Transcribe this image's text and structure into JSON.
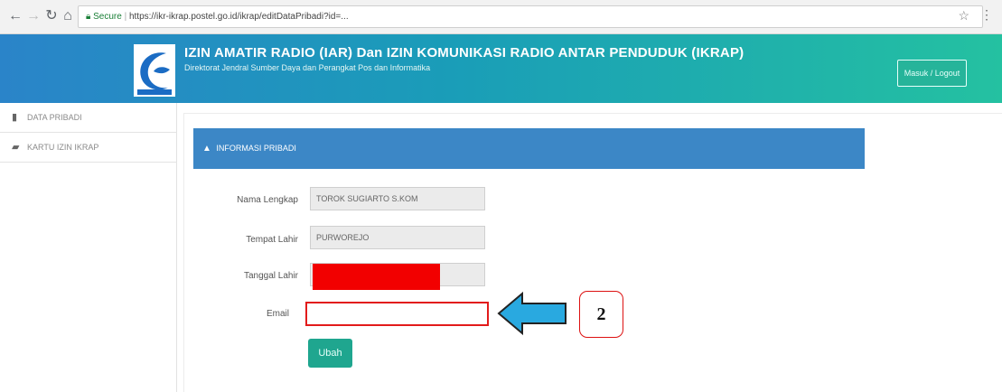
{
  "browser": {
    "secure_label": "Secure",
    "url": "https://ikr-ikrap.postel.go.id/ikrap/editDataPribadi?id=..."
  },
  "header": {
    "title": "IZIN AMATIR RADIO (IAR) Dan IZIN KOMUNIKASI RADIO ANTAR PENDUDUK (IKRAP)",
    "subtitle": "Direktorat Jendral Sumber Daya dan Perangkat Pos dan Informatika",
    "action_button": "Masuk / Logout"
  },
  "sidebar": {
    "items": [
      {
        "label": "DATA PRIBADI",
        "icon": "user-icon"
      },
      {
        "label": "KARTU IZIN IKRAP",
        "icon": "card-icon"
      }
    ]
  },
  "panel": {
    "title": "INFORMASI PRIBADI"
  },
  "form": {
    "nama_label": "Nama Lengkap",
    "nama_value": "TOROK SUGIARTO S.KOM",
    "tempat_label": "Tempat Lahir",
    "tempat_value": "PURWOREJO",
    "tanggal_label": "Tanggal Lahir",
    "email_label": "Email",
    "email_value": "",
    "submit_label": "Ubah"
  },
  "annotation": {
    "step_number": "2",
    "arrow_color": "#29a9e0",
    "highlight_color": "#e21b1b"
  },
  "colors": {
    "panel_header": "#3c87c6",
    "button": "#1fa68f",
    "banner_start": "#2a84c9",
    "banner_end": "#24c1a1"
  }
}
